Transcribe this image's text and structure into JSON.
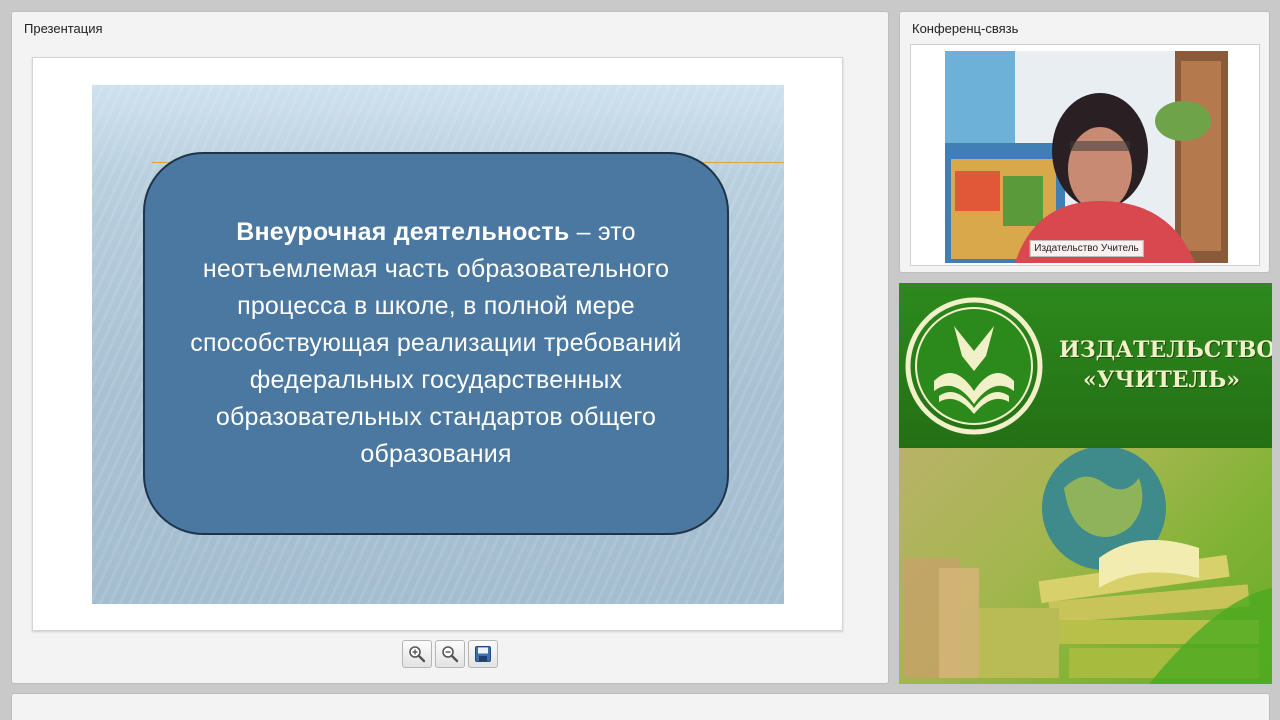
{
  "presentation": {
    "title": "Презентация",
    "slide": {
      "bold_text": "Внеурочная деятельность",
      "rest_text": " – это неотъемлемая часть образовательного процесса в школе, в полной мере способствующая реализации требований федеральных государственных образовательных стандартов общего образования"
    },
    "toolbar": {
      "zoom_in_icon": "zoom-in-icon",
      "zoom_out_icon": "zoom-out-icon",
      "save_icon": "save-icon"
    }
  },
  "conference": {
    "title": "Конференц-связь",
    "video_label": "Издательство Учитель"
  },
  "banner": {
    "line1": "ИЗДАТЕЛЬСТВО",
    "line2": "«УЧИТЕЛЬ»",
    "colors": {
      "green": "#2d8a1d",
      "cream": "#f2f0c8"
    }
  }
}
